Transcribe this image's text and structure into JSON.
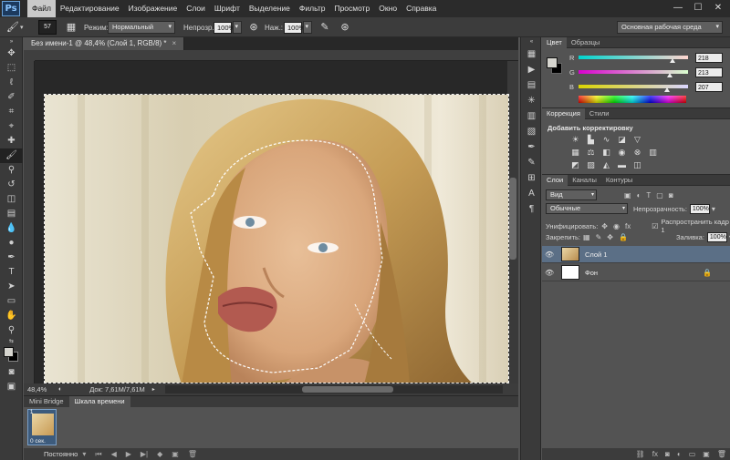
{
  "app": {
    "logo": "Ps",
    "menu": [
      "Файл",
      "Редактирование",
      "Изображение",
      "Слои",
      "Шрифт",
      "Выделение",
      "Фильтр",
      "Просмотр",
      "Окно",
      "Справка"
    ],
    "window_controls": [
      "—",
      "☐",
      "✕"
    ]
  },
  "options": {
    "brush_size": "57",
    "mode_label": "Режим:",
    "mode_value": "Нормальный",
    "opacity_label": "Непрозр.:",
    "opacity_value": "100%",
    "flow_label": "Наж.:",
    "flow_value": "100%",
    "workspace": "Основная рабочая среда"
  },
  "document": {
    "tab_title": "Без имени-1 @ 48,4% (Слой 1, RGB/8) *",
    "tab_close": "×",
    "zoom": "48,4%",
    "doc_size": "Док: 7,61M/7,61M"
  },
  "timeline": {
    "tabs": [
      "Mini Bridge",
      "Шкала времени"
    ],
    "frame_number": "1",
    "frame_time": "0 сек.",
    "loop": "Постоянно"
  },
  "color_panel": {
    "tabs": [
      "Цвет",
      "Образцы"
    ],
    "channels": [
      {
        "name": "R",
        "value": "218",
        "fraction": 0.855
      },
      {
        "name": "G",
        "value": "213",
        "fraction": 0.835
      },
      {
        "name": "B",
        "value": "207",
        "fraction": 0.812
      }
    ]
  },
  "adjustments": {
    "tabs": [
      "Коррекция",
      "Стили"
    ],
    "title": "Добавить корректировку"
  },
  "layers_panel": {
    "tabs": [
      "Слои",
      "Каналы",
      "Контуры"
    ],
    "filter": "Вид",
    "blend_mode": "Обычные",
    "opacity_label": "Непрозрачность:",
    "opacity_value": "100%",
    "unify_label": "Унифицировать:",
    "propagate_label": "Распространить кадр 1",
    "lock_label": "Закрепить:",
    "fill_label": "Заливка:",
    "fill_value": "100%",
    "layers": [
      {
        "name": "Слой 1",
        "selected": true
      },
      {
        "name": "Фон",
        "selected": false
      }
    ]
  }
}
